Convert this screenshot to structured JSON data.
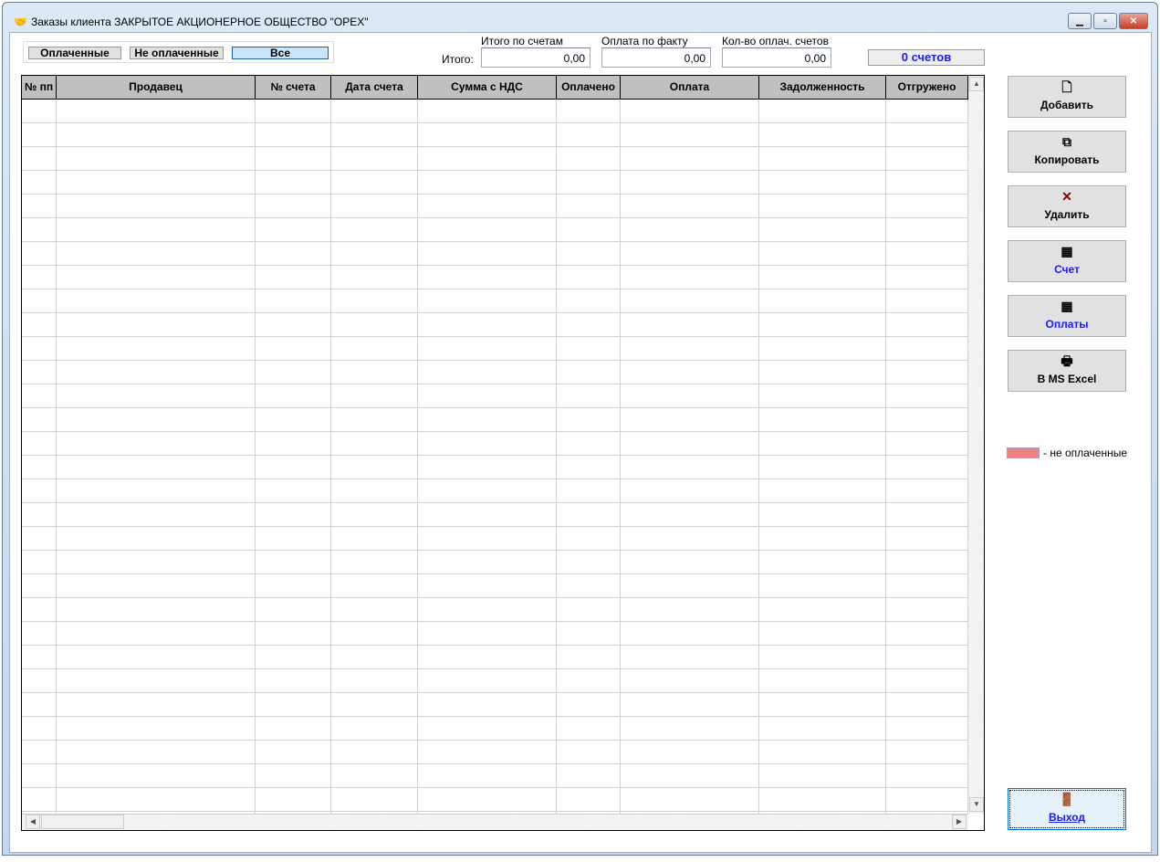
{
  "window": {
    "title": "Заказы клиента ЗАКРЫТОЕ АКЦИОНЕРНОЕ ОБЩЕСТВО \"ОРЕХ\"",
    "icon": "handshake-icon",
    "controls": [
      "minimize",
      "maximize",
      "close"
    ]
  },
  "filters": {
    "paid": "Оплаченные",
    "unpaid": "Не оплаченные",
    "all": "Все",
    "selected": "Все"
  },
  "totals": {
    "label": "Итого:",
    "invoices_label": "Итого по счетам",
    "invoices_value": "0,00",
    "paid_label": "Оплата по факту",
    "paid_value": "0,00",
    "count_label": "Кол-во оплач. счетов",
    "count_value": "0,00",
    "invoice_count": "0 счетов"
  },
  "table": {
    "columns": [
      "№ пп",
      "Продавец",
      "№ счета",
      "Дата счета",
      "Сумма с НДС",
      "Оплачено",
      "Оплата",
      "Задолженность",
      "Отгружено"
    ],
    "rows": []
  },
  "buttons": {
    "add": "Добавить",
    "copy": "Копировать",
    "delete": "Удалить",
    "invoice": "Счет",
    "payments": "Оплаты",
    "excel": "В MS Excel",
    "exit": "Выход"
  },
  "legend": {
    "text": "- не оплаченные",
    "color": "#f08080"
  },
  "colors": {
    "accent_blue": "#1a1aff",
    "selected_filter": "#cce4f7"
  }
}
